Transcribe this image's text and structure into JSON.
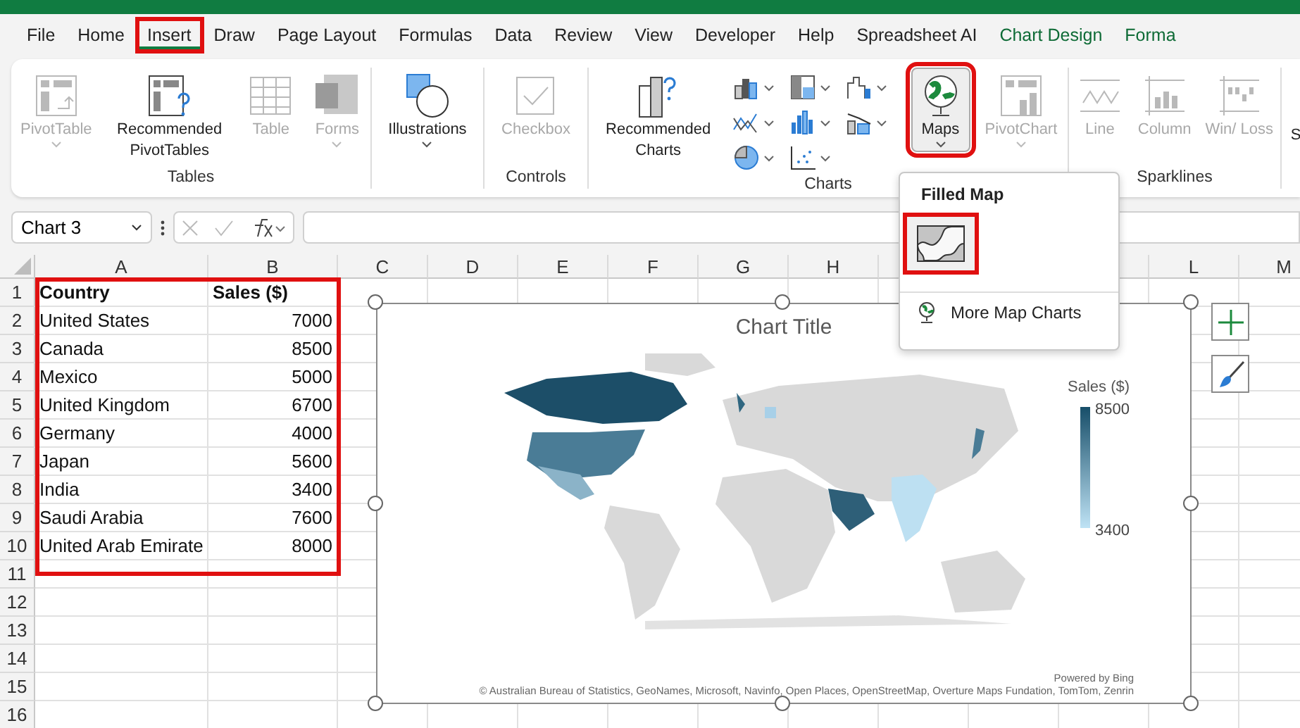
{
  "tabs": [
    {
      "label": "File",
      "selected": false,
      "kind": "normal",
      "highlighted": false
    },
    {
      "label": "Home",
      "selected": false,
      "kind": "normal",
      "highlighted": false
    },
    {
      "label": "Insert",
      "selected": true,
      "kind": "normal",
      "highlighted": true
    },
    {
      "label": "Draw",
      "selected": false,
      "kind": "normal",
      "highlighted": false
    },
    {
      "label": "Page Layout",
      "selected": false,
      "kind": "normal",
      "highlighted": false
    },
    {
      "label": "Formulas",
      "selected": false,
      "kind": "normal",
      "highlighted": false
    },
    {
      "label": "Data",
      "selected": false,
      "kind": "normal",
      "highlighted": false
    },
    {
      "label": "Review",
      "selected": false,
      "kind": "normal",
      "highlighted": false
    },
    {
      "label": "View",
      "selected": false,
      "kind": "normal",
      "highlighted": false
    },
    {
      "label": "Developer",
      "selected": false,
      "kind": "normal",
      "highlighted": false
    },
    {
      "label": "Help",
      "selected": false,
      "kind": "normal",
      "highlighted": false
    },
    {
      "label": "Spreadsheet AI",
      "selected": false,
      "kind": "normal",
      "highlighted": false
    },
    {
      "label": "Chart Design",
      "selected": false,
      "kind": "contextual",
      "highlighted": false
    },
    {
      "label": "Forma",
      "selected": false,
      "kind": "contextual",
      "highlighted": false
    }
  ],
  "ribbon": {
    "groups": [
      {
        "label": "Tables",
        "items": [
          {
            "kind": "pivot-table",
            "label": "PivotTable",
            "disabled": true,
            "dropdown": true
          },
          {
            "kind": "recommended-pivot",
            "label": "Recommended PivotTables",
            "disabled": false,
            "dropdown": false
          },
          {
            "kind": "table",
            "label": "Table",
            "disabled": true,
            "dropdown": false
          },
          {
            "kind": "forms",
            "label": "Forms",
            "disabled": true,
            "dropdown": true
          }
        ]
      },
      {
        "items": [
          {
            "kind": "illustrations",
            "label": "Illustrations",
            "disabled": false,
            "dropdown": true
          }
        ]
      },
      {
        "label": "Controls",
        "items": [
          {
            "kind": "checkbox",
            "label": "Checkbox",
            "disabled": true,
            "dropdown": false
          }
        ]
      },
      {
        "label": "Charts",
        "items": [
          {
            "kind": "recommended-charts",
            "label": "Recommended Charts",
            "disabled": false,
            "dropdown": false
          },
          {
            "kind": "gallery",
            "gallery": [
              {
                "kind": "bar"
              },
              {
                "kind": "line"
              },
              {
                "kind": "pie"
              },
              {
                "kind": "hierarchy"
              },
              {
                "kind": "statistic"
              },
              {
                "kind": "scatter"
              },
              {
                "kind": "waterfall"
              },
              {
                "kind": "combo"
              }
            ]
          },
          {
            "kind": "maps",
            "label": "Maps",
            "disabled": false,
            "dropdown": true,
            "highlighted": true,
            "pressed": true
          },
          {
            "kind": "pivot-chart",
            "label": "PivotChart",
            "disabled": true,
            "dropdown": true
          }
        ]
      },
      {
        "label": "Sparklines",
        "items": [
          {
            "kind": "spark-line",
            "label": "Line",
            "disabled": true,
            "dropdown": false
          },
          {
            "kind": "spark-column",
            "label": "Column",
            "disabled": true,
            "dropdown": false
          },
          {
            "kind": "spark-winloss",
            "label": "Win/ Loss",
            "disabled": true,
            "dropdown": false
          }
        ]
      },
      {
        "items": [
          {
            "kind": "cut",
            "label": "S"
          }
        ]
      }
    ]
  },
  "formula_bar": {
    "name_box": "Chart 3"
  },
  "sheet": {
    "columns": [
      "A",
      "B",
      "C",
      "D",
      "E",
      "F",
      "G",
      "H",
      null,
      null,
      null,
      "L",
      "M"
    ],
    "row_numbers": [
      "1",
      "2",
      "3",
      "4",
      "5",
      "6",
      "7",
      "8",
      "9",
      "10",
      "11",
      "12",
      "13",
      "14",
      "15",
      "16"
    ],
    "header": [
      "Country",
      "Sales ($)"
    ],
    "rows": [
      [
        "United States",
        "7000"
      ],
      [
        "Canada",
        "8500"
      ],
      [
        "Mexico",
        "5000"
      ],
      [
        "United Kingdom",
        "6700"
      ],
      [
        "Germany",
        "4000"
      ],
      [
        "Japan",
        "5600"
      ],
      [
        "India",
        "3400"
      ],
      [
        "Saudi Arabia",
        "7600"
      ],
      [
        "United Arab Emirate",
        "8000"
      ]
    ],
    "highlighted": true
  },
  "chart": {
    "title": "Chart Title",
    "selected": true,
    "legend": {
      "title": "Sales ($)",
      "max": "8500",
      "min": "3400"
    },
    "powered_by": "Powered by Bing",
    "attribution": "© Australian Bureau of Statistics, GeoNames, Microsoft, Navinfo, Open Places, OpenStreetMap, Overture Maps Fundation, TomTom, Zenrin"
  },
  "maps_menu": {
    "heading": "Filled Map",
    "options": [
      {
        "selected": true,
        "highlighted": true
      }
    ],
    "more": "More Map Charts"
  }
}
